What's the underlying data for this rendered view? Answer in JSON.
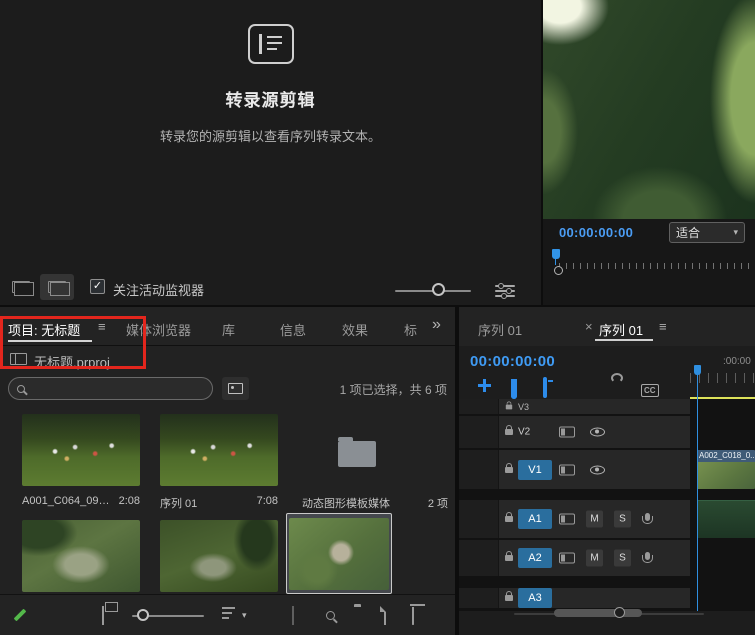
{
  "icons": {
    "menu": "≡",
    "overflow": "»",
    "chevron_down": "▾",
    "close": "×",
    "check": "✓",
    "captions": "CC"
  },
  "transcribe_panel": {
    "title": "转录源剪辑",
    "description": "转录您的源剪辑以查看序列转录文本。",
    "follow_monitor_label": "关注活动监视器"
  },
  "source_monitor": {
    "timecode": "00:00:00:00",
    "fit_label": "适合"
  },
  "project_panel": {
    "tabs": {
      "project": "项目: 无标题",
      "media_browser": "媒体浏览器",
      "libraries": "库",
      "info": "信息",
      "effects": "效果",
      "partial": "标"
    },
    "project_file": "无标题.prproj",
    "selection_status": "1 项已选择，共 6 项",
    "items": [
      {
        "name": "A001_C064_09224...",
        "meta": "2:08"
      },
      {
        "name": "序列 01",
        "meta": "7:08"
      },
      {
        "name": "动态图形模板媒体",
        "meta": "2 项"
      }
    ]
  },
  "timeline_panel": {
    "tabs": {
      "first": "序列 01",
      "second": "序列 01"
    },
    "timecode": "00:00:00:00",
    "ruler_label": ":00:00",
    "tracks": {
      "v3": "V3",
      "v2": "V2",
      "v1": "V1",
      "a1": "A1",
      "a2": "A2",
      "a3": "A3"
    },
    "mute_label": "M",
    "solo_label": "S",
    "clip_label": "A002_C018_0..."
  },
  "colors": {
    "accent_blue": "#2d8ceb",
    "timecode_blue": "#3f9bf4",
    "annotation_red": "#e3261d",
    "playhead_blue": "#2f8fe0",
    "selection_yellow": "#dde25a",
    "pencil_green": "#53b84a"
  }
}
